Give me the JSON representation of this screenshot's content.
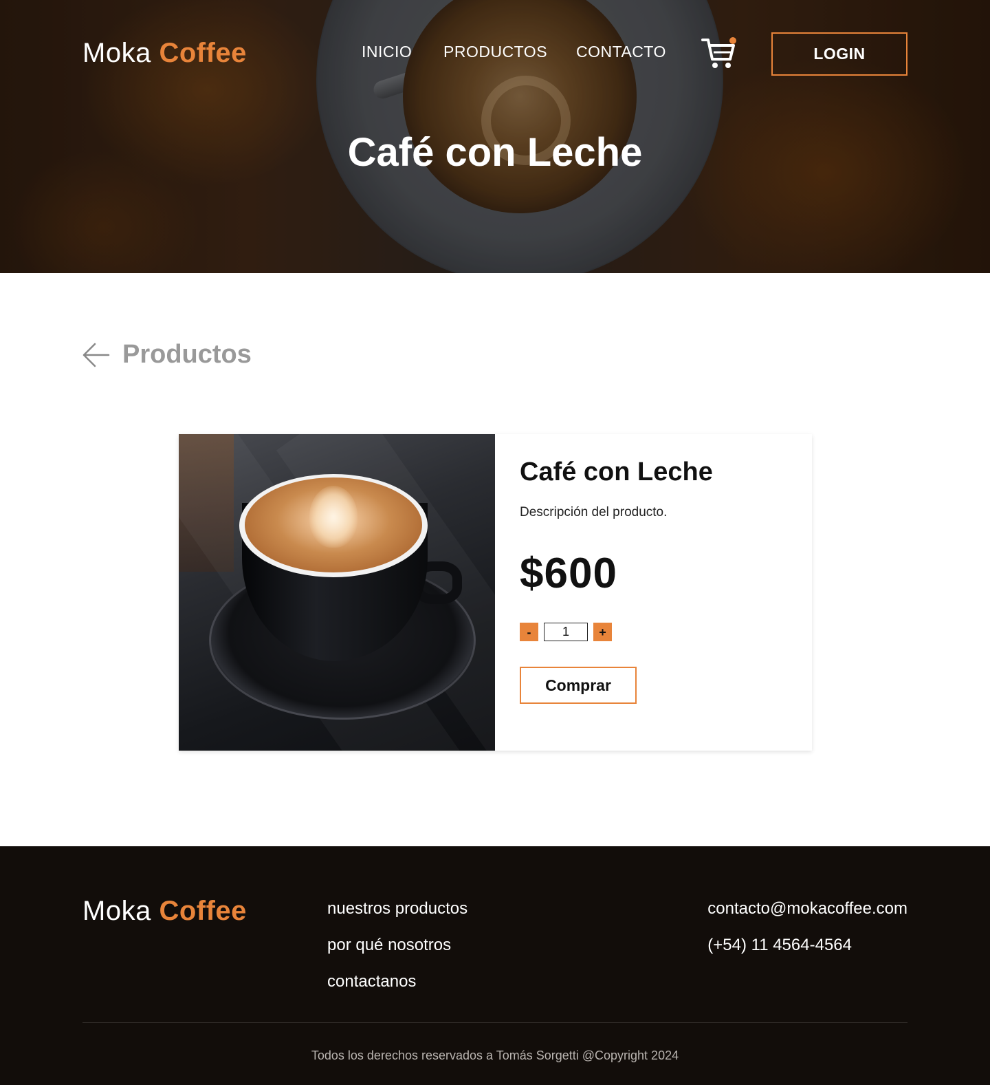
{
  "brand": {
    "name_part1": "Moka",
    "name_part2": "Coffee",
    "accent_color": "#e8843a"
  },
  "nav": {
    "items": [
      {
        "label": "INICIO"
      },
      {
        "label": "PRODUCTOS"
      },
      {
        "label": "CONTACTO"
      }
    ],
    "cart_icon": "shopping-cart-icon",
    "login_label": "LOGIN"
  },
  "hero": {
    "title": "Café con Leche"
  },
  "back_link": {
    "icon": "arrow-left-icon",
    "label": "Productos"
  },
  "product": {
    "name": "Café con Leche",
    "description": "Descripción del producto.",
    "price": "$600",
    "quantity": "1",
    "decrement_label": "-",
    "increment_label": "+",
    "buy_label": "Comprar"
  },
  "footer": {
    "links": [
      {
        "label": "nuestros productos"
      },
      {
        "label": "por qué nosotros"
      },
      {
        "label": "contactanos"
      }
    ],
    "email": "contacto@mokacoffee.com",
    "phone": "(+54) 11 4564-4564",
    "copyright": "Todos los derechos reservados a Tomás Sorgetti @Copyright 2024",
    "background_color": "#120d0a"
  }
}
